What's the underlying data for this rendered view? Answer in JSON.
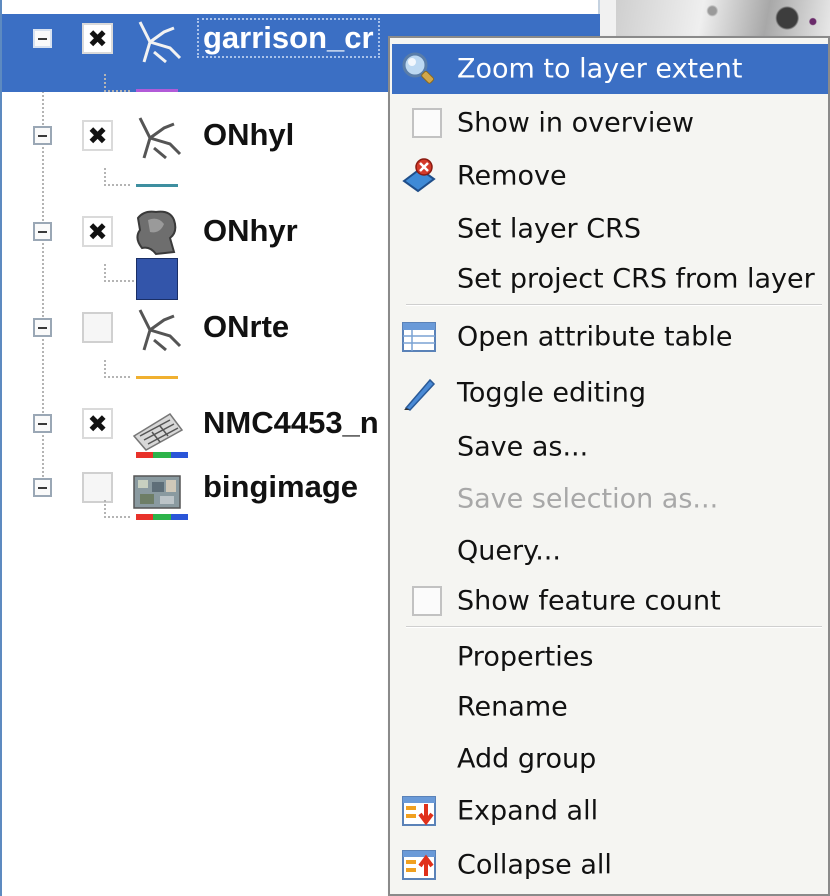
{
  "layers_panel": {
    "layers": [
      {
        "name": "garrison_cr",
        "checked": true,
        "selected": true,
        "icon": "line-layer-icon",
        "legend": "line",
        "legend_color": "#b25ad8"
      },
      {
        "name": "ONhyl",
        "checked": true,
        "selected": false,
        "icon": "line-layer-icon",
        "legend": "line",
        "legend_color": "#3e8fa0"
      },
      {
        "name": "ONhyr",
        "checked": true,
        "selected": false,
        "icon": "polygon-layer-icon",
        "legend": "box",
        "legend_color": "#3355aa"
      },
      {
        "name": "ONrte",
        "checked": false,
        "selected": false,
        "icon": "line-layer-icon",
        "legend": "line",
        "legend_color": "#f0b030"
      },
      {
        "name": "NMC4453_n",
        "checked": true,
        "selected": false,
        "icon": "raster-layer-icon",
        "legend": "rgb"
      },
      {
        "name": "bingimage",
        "checked": false,
        "selected": false,
        "icon": "raster-layer-icon",
        "legend": "rgb"
      }
    ]
  },
  "context_menu": {
    "items": [
      {
        "label": "Zoom to layer extent",
        "icon": "zoom-icon",
        "highlighted": true
      },
      {
        "label": "Show in overview",
        "icon": "checkbox"
      },
      {
        "label": "Remove",
        "icon": "remove-icon"
      },
      {
        "label": "Set layer CRS"
      },
      {
        "label": "Set project CRS from layer"
      },
      {
        "label": "Open attribute table",
        "icon": "table-icon"
      },
      {
        "label": "Toggle editing",
        "icon": "pencil-icon"
      },
      {
        "label": "Save as...",
        "icon": ""
      },
      {
        "label": "Save selection as...",
        "disabled": true
      },
      {
        "label": "Query..."
      },
      {
        "label": "Show feature count",
        "icon": "checkbox"
      },
      {
        "label": "Properties"
      },
      {
        "label": "Rename"
      },
      {
        "label": "Add group"
      },
      {
        "label": "Expand all",
        "icon": "expand-icon"
      },
      {
        "label": "Collapse all",
        "icon": "collapse-icon"
      }
    ]
  },
  "colors": {
    "selection": "#3b6fc4",
    "legend_rgb": [
      "#e8322a",
      "#2cb34a",
      "#2a55d8"
    ]
  }
}
